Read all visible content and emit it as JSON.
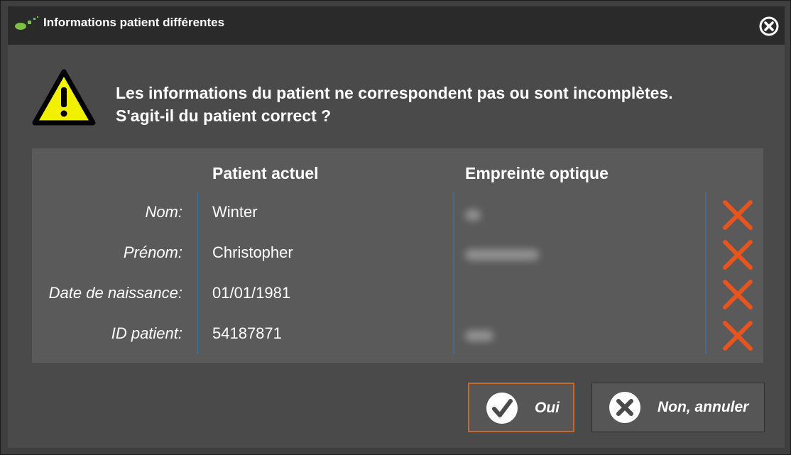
{
  "window": {
    "title": "Informations patient différentes"
  },
  "message": {
    "line1": "Les informations du patient ne correspondent pas ou sont incomplètes.",
    "line2": "S'agit-il du patient correct ?"
  },
  "table": {
    "headers": {
      "current": "Patient actuel",
      "optical": "Empreinte optique"
    },
    "rows": [
      {
        "label": "Nom:",
        "current": "Winter",
        "optical_redacted": true,
        "match": false
      },
      {
        "label": "Prénom:",
        "current": "Christopher",
        "optical_redacted": true,
        "match": false
      },
      {
        "label": "Date de naissance:",
        "current": "01/01/1981",
        "optical_redacted": false,
        "match": false
      },
      {
        "label": "ID patient:",
        "current": "54187871",
        "optical_redacted": true,
        "match": false
      }
    ]
  },
  "buttons": {
    "yes": "Oui",
    "no": "Non, annuler"
  },
  "colors": {
    "accent_orange": "#e8541e",
    "warning_yellow": "#f0f000",
    "separator_blue": "#3f6d91"
  }
}
